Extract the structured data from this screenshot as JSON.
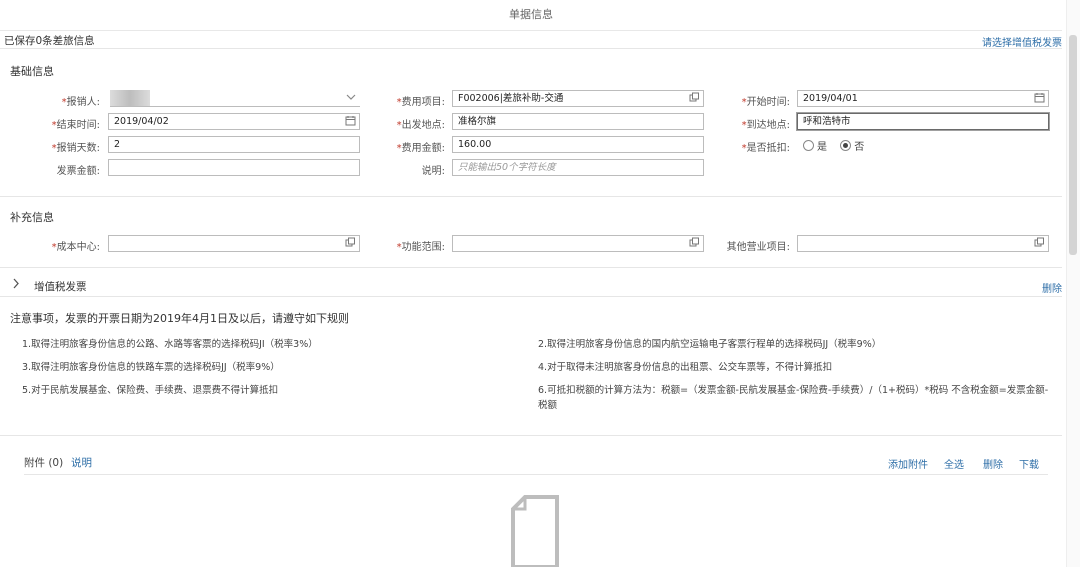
{
  "header": {
    "title": "单据信息"
  },
  "saved_info": "已保存0条差旅信息",
  "select_vat_link": "请选择增值税发票",
  "basic": {
    "section_title": "基础信息",
    "fields": {
      "reimburser": {
        "label": "*报销人:",
        "value": ""
      },
      "expense_item": {
        "label": "*费用项目:",
        "value": "F002006|差旅补助-交通"
      },
      "start_time": {
        "label": "*开始时间:",
        "value": "2019/04/01"
      },
      "end_time": {
        "label": "*结束时间:",
        "value": "2019/04/02"
      },
      "departure": {
        "label": "*出发地点:",
        "value": "准格尔旗"
      },
      "arrival": {
        "label": "*到达地点:",
        "value": "呼和浩特市"
      },
      "days": {
        "label": "*报销天数:",
        "value": "2"
      },
      "amount": {
        "label": "*费用金额:",
        "value": "160.00"
      },
      "deductible": {
        "label": "*是否抵扣:",
        "options": [
          "是",
          "否"
        ],
        "selected": "否"
      },
      "invoice_amount": {
        "label": "发票金额:",
        "value": ""
      },
      "description": {
        "label": "说明:",
        "placeholder": "只能输出50个字符长度"
      }
    }
  },
  "supplement": {
    "section_title": "补充信息",
    "fields": {
      "cost_center": {
        "label": "*成本中心:",
        "value": ""
      },
      "function_scope": {
        "label": "*功能范围:",
        "value": ""
      },
      "other_business": {
        "label": "其他营业项目:",
        "value": ""
      }
    }
  },
  "vat": {
    "title": "增值税发票",
    "delete_label": "删除"
  },
  "notice": {
    "title": "注意事项，发票的开票日期为2019年4月1日及以后，请遵守如下规则",
    "rules": [
      "1.取得注明旅客身份信息的公路、水路等客票的选择税码JI（税率3%）",
      "2.取得注明旅客身份信息的国内航空运输电子客票行程单的选择税码JJ（税率9%）",
      "3.取得注明旅客身份信息的铁路车票的选择税码JJ（税率9%）",
      "4.对于取得未注明旅客身份信息的出租票、公交车票等，不得计算抵扣",
      "5.对于民航发展基金、保险费、手续费、退票费不得计算抵扣",
      "6.可抵扣税额的计算方法为：税额=（发票金额-民航发展基金-保险费-手续费）/（1+税码）*税码 不含税金额=发票金额-税额"
    ]
  },
  "attachments": {
    "title": "附件 (0)",
    "explain_link": "说明",
    "actions": [
      "添加附件",
      "全选",
      "删除",
      "下载"
    ]
  },
  "icons": {
    "dropdown": "chevron-down-icon",
    "value_help": "value-help-icon",
    "calendar": "calendar-icon",
    "expand": "chevron-right-icon",
    "document": "document-icon"
  }
}
